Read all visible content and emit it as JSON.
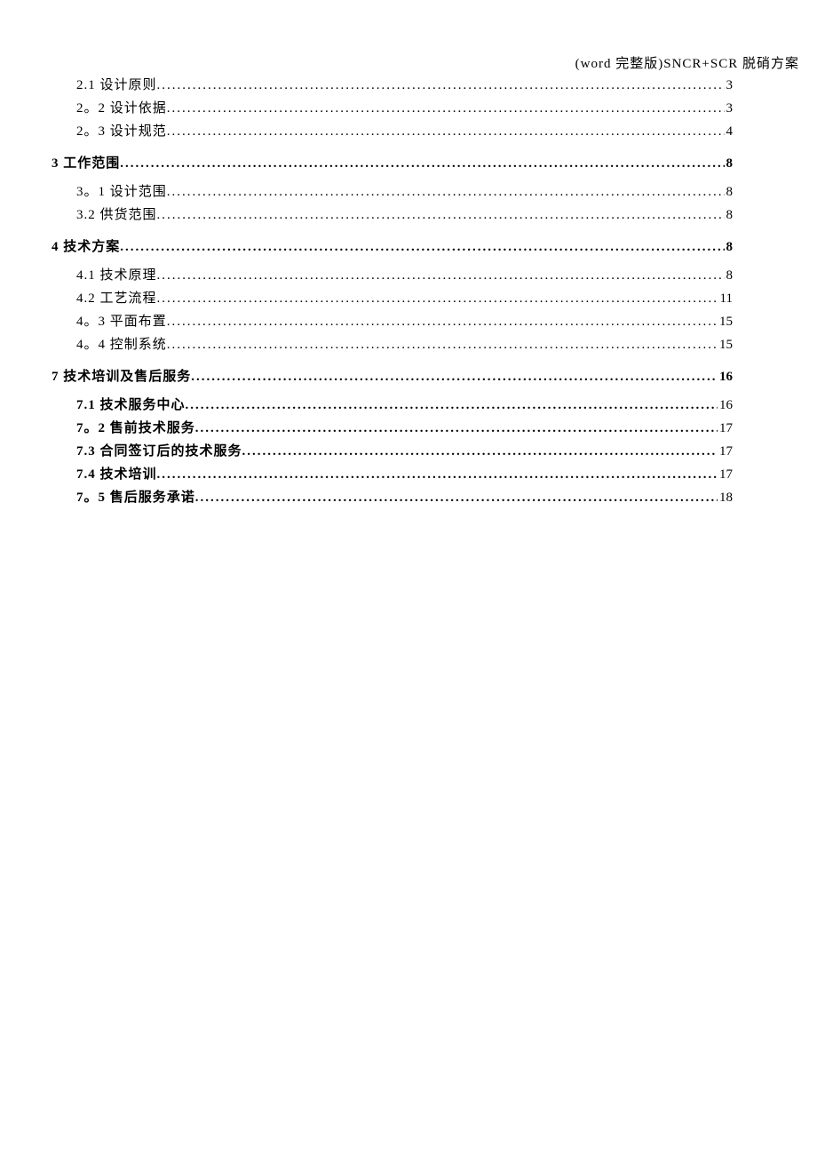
{
  "header": "(word 完整版)SNCR+SCR 脱硝方案",
  "toc": [
    {
      "level": 2,
      "bold": false,
      "title": "2.1 设计原则",
      "page": "3"
    },
    {
      "level": 2,
      "bold": false,
      "title": "2。2 设计依据",
      "page": "3"
    },
    {
      "level": 2,
      "bold": false,
      "title": "2。3 设计规范",
      "page": "4"
    },
    {
      "level": 1,
      "bold": true,
      "title": "3 工作范围",
      "page": "8"
    },
    {
      "level": 2,
      "bold": false,
      "title": "3。1 设计范围",
      "page": "8"
    },
    {
      "level": 2,
      "bold": false,
      "title": "3.2 供货范围",
      "page": "8"
    },
    {
      "level": 1,
      "bold": true,
      "title": "4 技术方案",
      "page": "8"
    },
    {
      "level": 2,
      "bold": false,
      "title": "4.1 技术原理",
      "page": "8"
    },
    {
      "level": 2,
      "bold": false,
      "title": "4.2 工艺流程",
      "page": "11"
    },
    {
      "level": 2,
      "bold": false,
      "title": "4。3 平面布置",
      "page": "15"
    },
    {
      "level": 2,
      "bold": false,
      "title": "4。4 控制系统",
      "page": "15"
    },
    {
      "level": 1,
      "bold": true,
      "title": "7 技术培训及售后服务",
      "page": "16"
    },
    {
      "level": 2,
      "bold": true,
      "title": "7.1 技术服务中心",
      "page": "16"
    },
    {
      "level": 2,
      "bold": true,
      "title": "7。2 售前技术服务",
      "page": "17"
    },
    {
      "level": 2,
      "bold": true,
      "title": "7.3 合同签订后的技术服务",
      "page": "17"
    },
    {
      "level": 2,
      "bold": true,
      "title": "7.4 技术培训",
      "page": "17"
    },
    {
      "level": 2,
      "bold": true,
      "title": "7。5 售后服务承诺",
      "page": "18"
    }
  ]
}
